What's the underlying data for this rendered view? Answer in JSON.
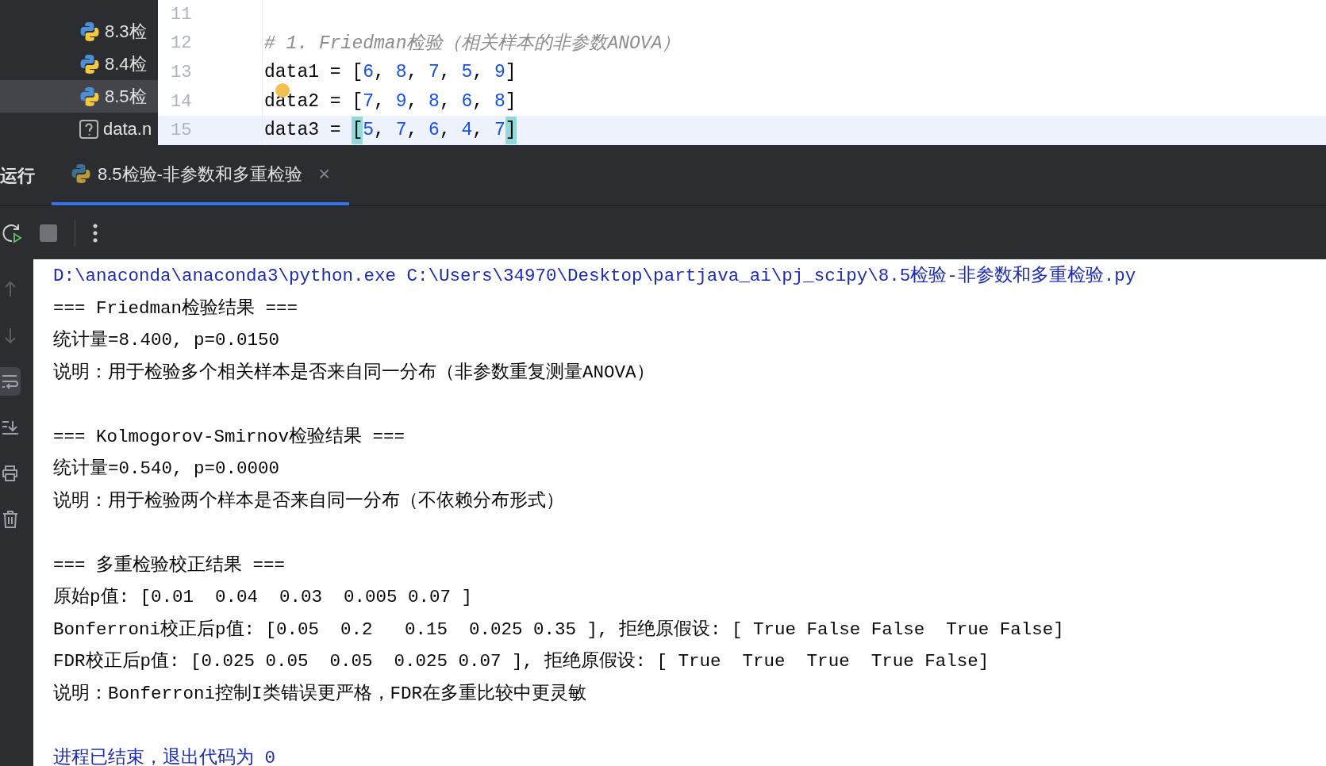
{
  "project_tree": {
    "items": [
      {
        "label": "8.3检",
        "kind": "python",
        "selected": false
      },
      {
        "label": "8.4检",
        "kind": "python",
        "selected": false
      },
      {
        "label": "8.5检",
        "kind": "python",
        "selected": true
      },
      {
        "label": "data.n",
        "kind": "unknown",
        "selected": false
      }
    ]
  },
  "editor": {
    "lines": [
      {
        "number": "11",
        "current": false
      },
      {
        "number": "12",
        "tokens": [
          {
            "kind": "comment",
            "text": "# 1. Friedman检验（相关样本的非参数ANOVA）"
          }
        ],
        "current": false
      },
      {
        "number": "13",
        "tokens": [
          {
            "kind": "text",
            "text": "data1 = ["
          },
          {
            "kind": "number",
            "text": "6"
          },
          {
            "kind": "text",
            "text": ", "
          },
          {
            "kind": "number",
            "text": "8"
          },
          {
            "kind": "text",
            "text": ", "
          },
          {
            "kind": "number",
            "text": "7"
          },
          {
            "kind": "text",
            "text": ", "
          },
          {
            "kind": "number",
            "text": "5"
          },
          {
            "kind": "text",
            "text": ", "
          },
          {
            "kind": "number",
            "text": "9"
          },
          {
            "kind": "text",
            "text": "]"
          }
        ],
        "current": false
      },
      {
        "number": "14",
        "tokens": [
          {
            "kind": "text",
            "text": "data2 = ["
          },
          {
            "kind": "number",
            "text": "7"
          },
          {
            "kind": "text",
            "text": ", "
          },
          {
            "kind": "number",
            "text": "9"
          },
          {
            "kind": "text",
            "text": ", "
          },
          {
            "kind": "number",
            "text": "8"
          },
          {
            "kind": "text",
            "text": ", "
          },
          {
            "kind": "number",
            "text": "6"
          },
          {
            "kind": "text",
            "text": ", "
          },
          {
            "kind": "number",
            "text": "8"
          },
          {
            "kind": "text",
            "text": "]"
          }
        ],
        "current": false,
        "marker": true
      },
      {
        "number": "15",
        "tokens": [
          {
            "kind": "text",
            "text": "data3 = "
          },
          {
            "kind": "match",
            "text": "["
          },
          {
            "kind": "number",
            "text": "5"
          },
          {
            "kind": "text",
            "text": ", "
          },
          {
            "kind": "number",
            "text": "7"
          },
          {
            "kind": "text",
            "text": ", "
          },
          {
            "kind": "number",
            "text": "6"
          },
          {
            "kind": "text",
            "text": ", "
          },
          {
            "kind": "number",
            "text": "4"
          },
          {
            "kind": "text",
            "text": ", "
          },
          {
            "kind": "number",
            "text": "7"
          },
          {
            "kind": "match",
            "text": "]"
          }
        ],
        "current": true
      }
    ]
  },
  "run_panel": {
    "title": "运行",
    "tabs": [
      {
        "label": "8.5检验-非参数和多重检验",
        "close": "×",
        "selected": true
      }
    ],
    "toolbar": [
      {
        "kind": "rerun"
      },
      {
        "kind": "stop"
      },
      {
        "kind": "more"
      }
    ],
    "side_tools": [
      {
        "kind": "up",
        "active": false
      },
      {
        "kind": "down",
        "active": false
      },
      {
        "kind": "wrap",
        "active": true
      },
      {
        "kind": "scroll_end",
        "active": false
      },
      {
        "kind": "print",
        "active": false
      },
      {
        "kind": "trash",
        "active": false
      }
    ],
    "console": {
      "blocks": [
        [
          {
            "kind": "command",
            "text": "D:\\anaconda\\anaconda3\\python.exe C:\\Users\\34970\\Desktop\\partjava_ai\\pj_scipy\\8.5检验-非参数和多重检验.py"
          },
          {
            "kind": "output",
            "text": "=== Friedman检验结果 ==="
          },
          {
            "kind": "output",
            "text": "统计量=8.400, p=0.0150"
          },
          {
            "kind": "output",
            "text": "说明：用于检验多个相关样本是否来自同一分布（非参数重复测量ANOVA）"
          }
        ],
        [
          {
            "kind": "output",
            "text": "=== Kolmogorov-Smirnov检验结果 ==="
          },
          {
            "kind": "output",
            "text": "统计量=0.540, p=0.0000"
          },
          {
            "kind": "output",
            "text": "说明：用于检验两个样本是否来自同一分布（不依赖分布形式）"
          }
        ],
        [
          {
            "kind": "output",
            "text": "=== 多重检验校正结果 ==="
          },
          {
            "kind": "output",
            "text": "原始p值: [0.01  0.04  0.03  0.005 0.07 ]"
          },
          {
            "kind": "output",
            "text": "Bonferroni校正后p值: [0.05  0.2   0.15  0.025 0.35 ], 拒绝原假设: [ True False False  True False]"
          },
          {
            "kind": "output",
            "text": "FDR校正后p值: [0.025 0.05  0.05  0.025 0.07 ], 拒绝原假设: [ True  True  True  True False]"
          },
          {
            "kind": "output",
            "text": "说明：Bonferroni控制I类错误更严格，FDR在多重比较中更灵敏"
          }
        ],
        [
          {
            "kind": "exit",
            "text": "进程已结束，退出代码为 0"
          }
        ]
      ]
    }
  }
}
